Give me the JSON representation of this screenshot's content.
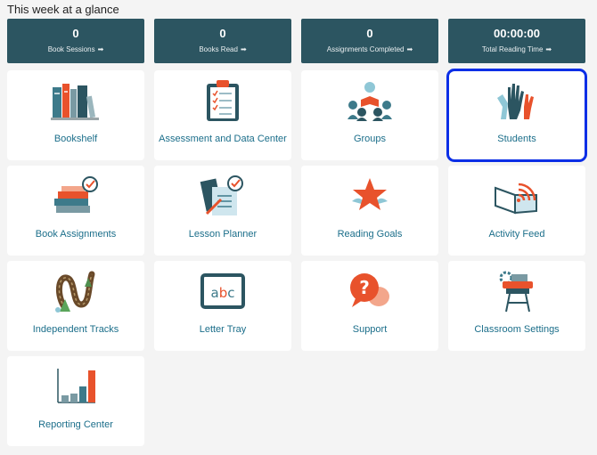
{
  "page": {
    "title": "This week at a glance"
  },
  "stats": [
    {
      "value": "0",
      "label": "Book Sessions"
    },
    {
      "value": "0",
      "label": "Books Read"
    },
    {
      "value": "0",
      "label": "Assignments Completed"
    },
    {
      "value": "00:00:00",
      "label": "Total Reading Time"
    }
  ],
  "stat_arrow": "➡",
  "tiles": [
    {
      "label": "Bookshelf",
      "icon": "bookshelf-icon"
    },
    {
      "label": "Assessment and Data Center",
      "icon": "clipboard-checklist-icon"
    },
    {
      "label": "Groups",
      "icon": "group-reading-icon"
    },
    {
      "label": "Students",
      "icon": "raised-hands-icon",
      "selected": true
    },
    {
      "label": "Book Assignments",
      "icon": "book-stack-check-icon"
    },
    {
      "label": "Lesson Planner",
      "icon": "lesson-planner-icon"
    },
    {
      "label": "Reading Goals",
      "icon": "star-icon"
    },
    {
      "label": "Activity Feed",
      "icon": "book-feed-icon"
    },
    {
      "label": "Independent Tracks",
      "icon": "winding-path-icon"
    },
    {
      "label": "Letter Tray",
      "icon": "abc-board-icon"
    },
    {
      "label": "Support",
      "icon": "question-bubble-icon"
    },
    {
      "label": "Classroom Settings",
      "icon": "desk-gear-icon"
    },
    {
      "label": "Reporting Center",
      "icon": "bar-chart-icon"
    }
  ],
  "colors": {
    "stat_bg": "#2c5561",
    "tile_label": "#1b6e8a",
    "selected_outline": "#0b2ee6",
    "accent_orange": "#e8522c",
    "accent_teal": "#3d7a8a"
  }
}
